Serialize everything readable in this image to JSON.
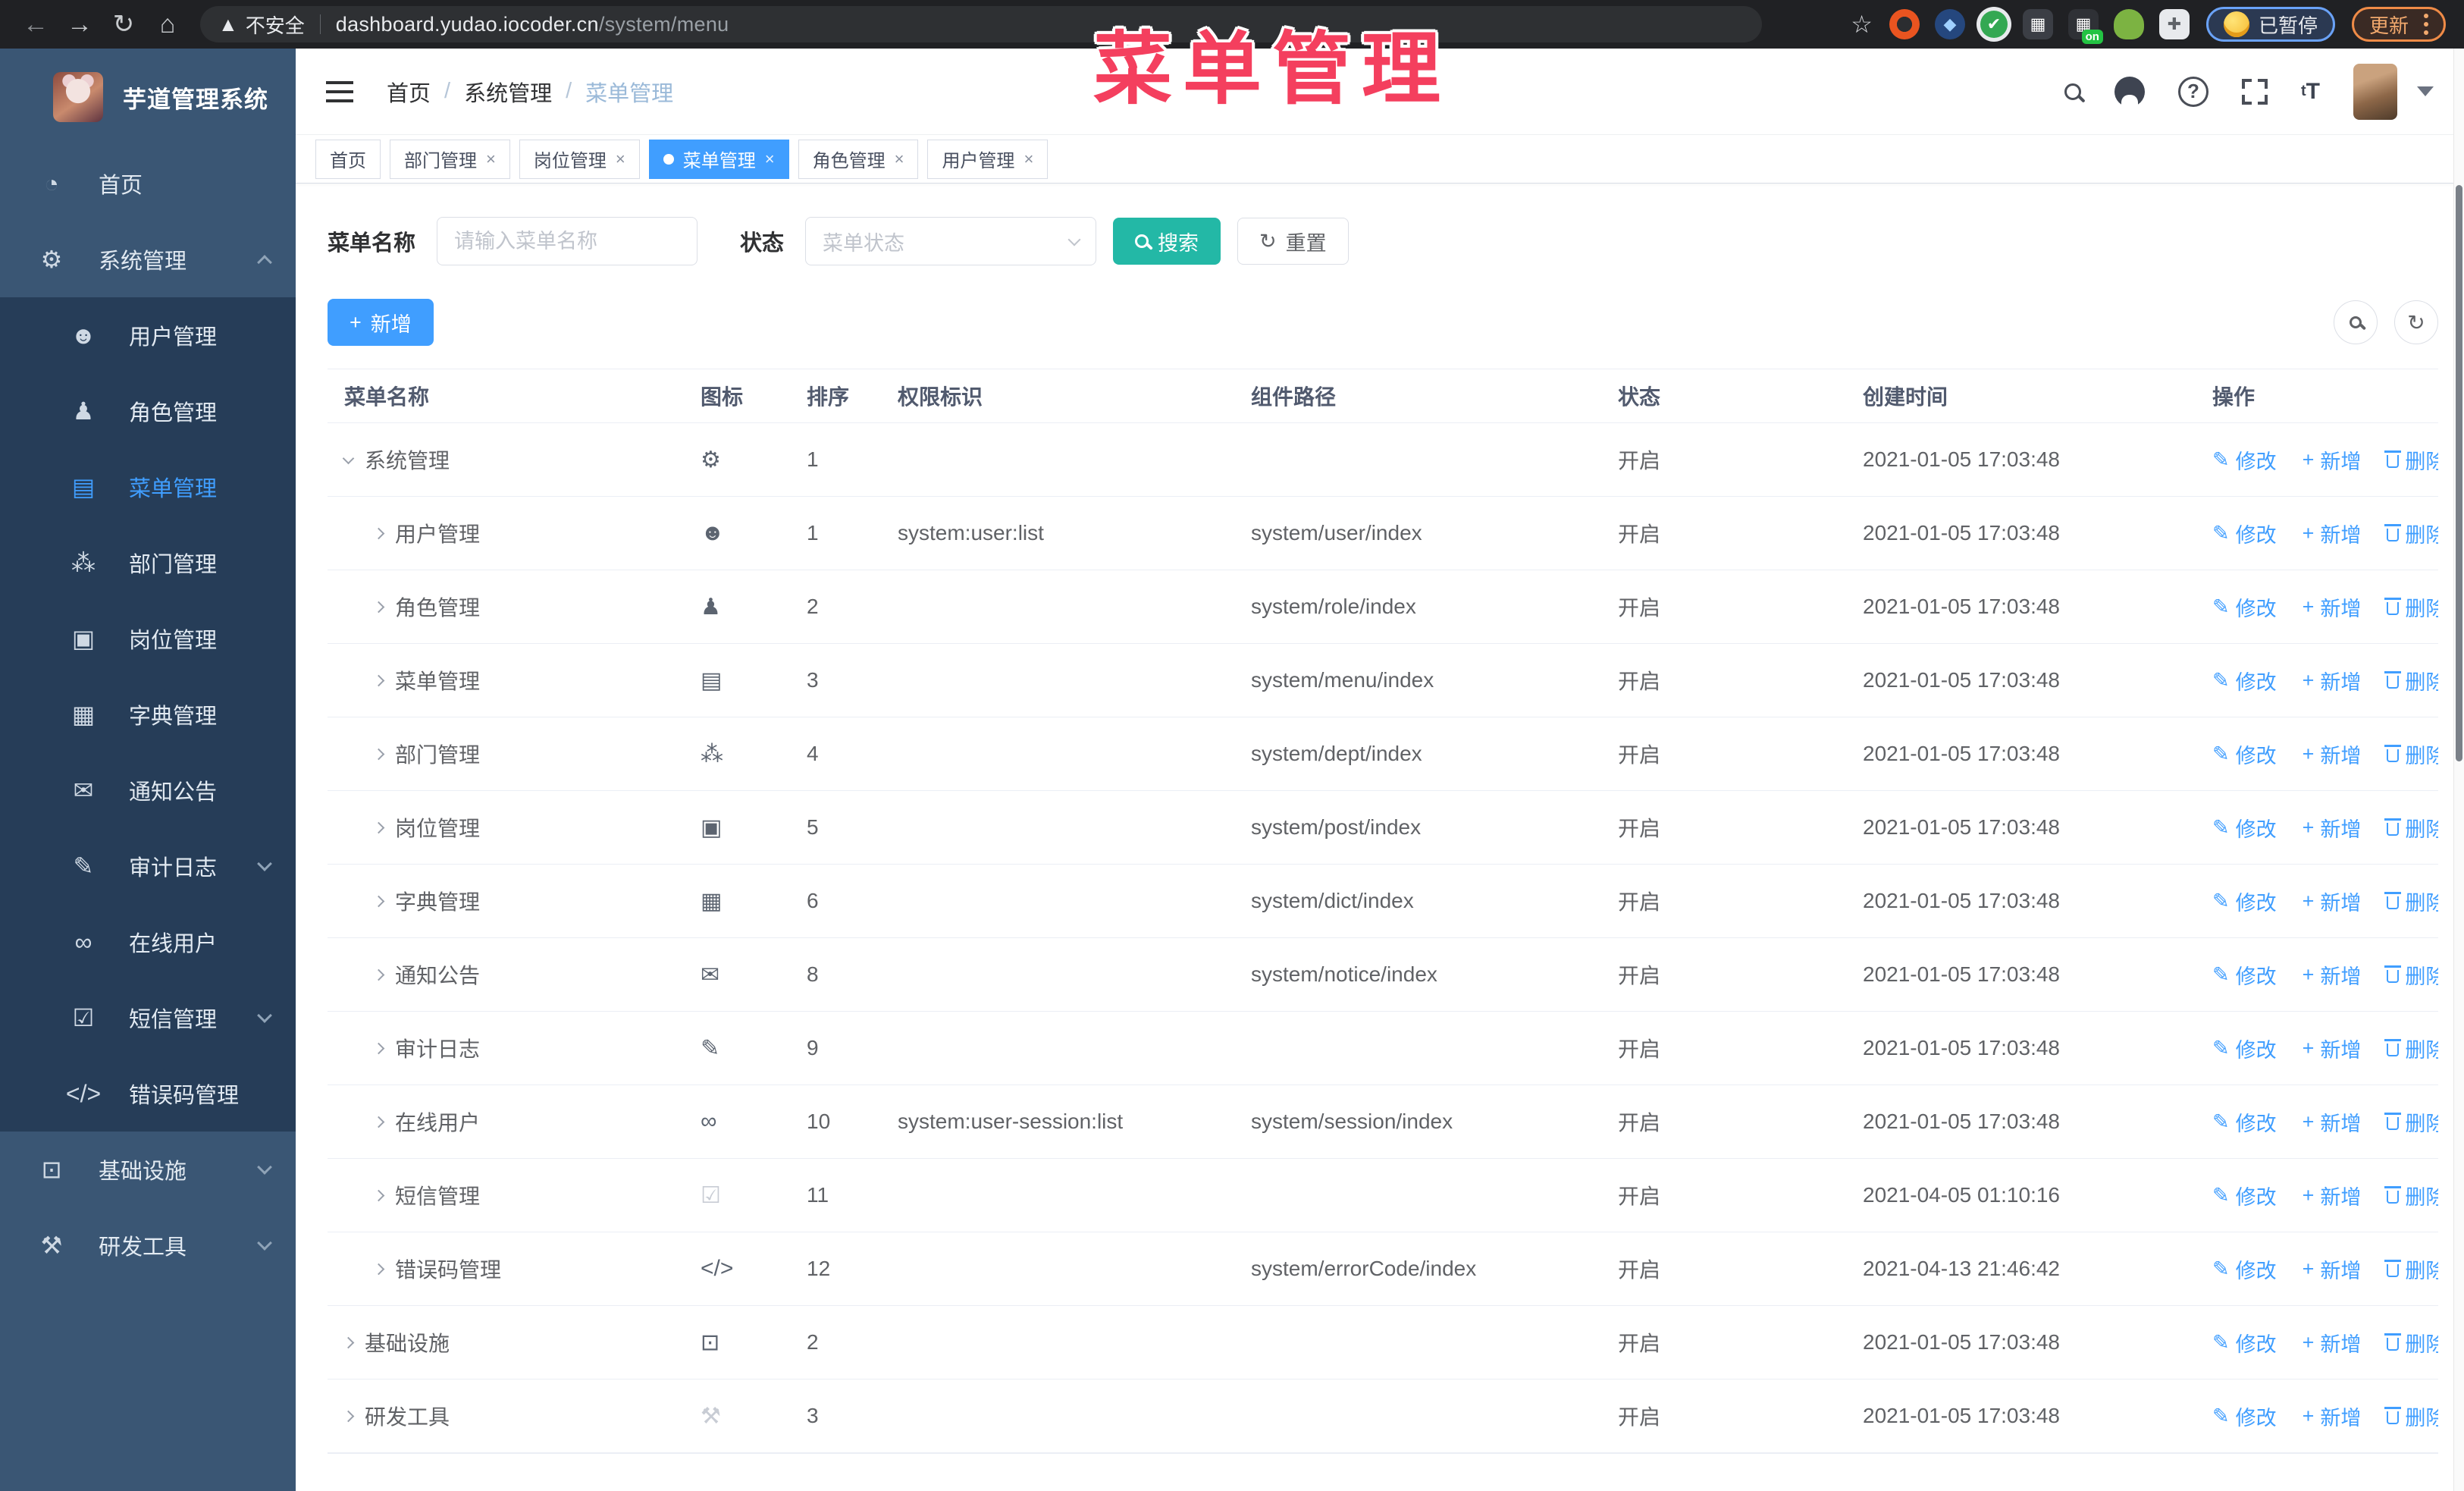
{
  "colors": {
    "accent": "#409eff",
    "search_button": "#23b8a6",
    "annotation": "#f43f5e",
    "sidebar_bg": "#3a5674",
    "submenu_bg": "#263d58"
  },
  "annotation": {
    "text": "菜单管理"
  },
  "browser": {
    "security_label": "不安全",
    "url_host": "dashboard.yudao.iocoder.cn",
    "url_path": "/system/menu",
    "paused_badge": "已暂停",
    "update_button": "更新",
    "nav_icons": [
      "back-icon",
      "forward-icon",
      "reload-icon",
      "home-icon"
    ],
    "extensions": [
      "ubuntu-orange-extension",
      "blue-gem-extension",
      "green-check-extension",
      "blue-grid-extension",
      "on-badge-extension",
      "green-bot-extension",
      "white-puzzle-extension"
    ],
    "on_badge": "on"
  },
  "sidebar": {
    "logo_title": "芋道管理系统",
    "items": [
      {
        "label": "首页",
        "icon": "dashboard-icon",
        "type": "root",
        "active": false,
        "chevron": ""
      },
      {
        "label": "系统管理",
        "icon": "gear-icon",
        "type": "root",
        "active": false,
        "chevron": "up"
      },
      {
        "label": "用户管理",
        "icon": "user-icon",
        "type": "sub",
        "active": false,
        "chevron": ""
      },
      {
        "label": "角色管理",
        "icon": "role-icon",
        "type": "sub",
        "active": false,
        "chevron": ""
      },
      {
        "label": "菜单管理",
        "icon": "menu-icon",
        "type": "sub",
        "active": true,
        "chevron": ""
      },
      {
        "label": "部门管理",
        "icon": "dept-icon",
        "type": "sub",
        "active": false,
        "chevron": ""
      },
      {
        "label": "岗位管理",
        "icon": "post-icon",
        "type": "sub",
        "active": false,
        "chevron": ""
      },
      {
        "label": "字典管理",
        "icon": "dict-icon",
        "type": "sub",
        "active": false,
        "chevron": ""
      },
      {
        "label": "通知公告",
        "icon": "notice-icon",
        "type": "sub",
        "active": false,
        "chevron": ""
      },
      {
        "label": "审计日志",
        "icon": "audit-icon",
        "type": "sub",
        "active": false,
        "chevron": "down"
      },
      {
        "label": "在线用户",
        "icon": "online-icon",
        "type": "sub",
        "active": false,
        "chevron": ""
      },
      {
        "label": "短信管理",
        "icon": "sms-icon",
        "type": "sub",
        "active": false,
        "chevron": "down"
      },
      {
        "label": "错误码管理",
        "icon": "errcode-icon",
        "type": "sub",
        "active": false,
        "chevron": ""
      },
      {
        "label": "基础设施",
        "icon": "infra-icon",
        "type": "root",
        "active": false,
        "chevron": "down"
      },
      {
        "label": "研发工具",
        "icon": "tools-icon",
        "type": "root",
        "active": false,
        "chevron": "down"
      }
    ]
  },
  "header": {
    "breadcrumb": [
      "首页",
      "系统管理",
      "菜单管理"
    ],
    "icons": [
      "search-icon",
      "github-icon",
      "help-icon",
      "fullscreen-icon",
      "font-size-icon",
      "avatar",
      "caret-down-icon"
    ],
    "font_size_glyph": "tT"
  },
  "tabs": [
    {
      "label": "首页",
      "closable": false,
      "active": false
    },
    {
      "label": "部门管理",
      "closable": true,
      "active": false
    },
    {
      "label": "岗位管理",
      "closable": true,
      "active": false
    },
    {
      "label": "菜单管理",
      "closable": true,
      "active": true
    },
    {
      "label": "角色管理",
      "closable": true,
      "active": false
    },
    {
      "label": "用户管理",
      "closable": true,
      "active": false
    }
  ],
  "filters": {
    "name_label": "菜单名称",
    "name_placeholder": "请输入菜单名称",
    "name_value": "",
    "status_label": "状态",
    "status_placeholder": "菜单状态",
    "search_button": "搜索",
    "reset_button": "重置"
  },
  "toolbar": {
    "add_button": "新增"
  },
  "table": {
    "columns": [
      "菜单名称",
      "图标",
      "排序",
      "权限标识",
      "组件路径",
      "状态",
      "创建时间",
      "操作"
    ],
    "actions": {
      "edit": "修改",
      "add": "新增",
      "delete": "删除"
    },
    "rows": [
      {
        "name": "系统管理",
        "icon": "gear-icon",
        "level": 0,
        "expanded": true,
        "sort": "1",
        "perm": "",
        "path": "",
        "status": "开启",
        "time": "2021-01-05 17:03:48"
      },
      {
        "name": "用户管理",
        "icon": "user-icon",
        "level": 1,
        "expanded": false,
        "sort": "1",
        "perm": "system:user:list",
        "path": "system/user/index",
        "status": "开启",
        "time": "2021-01-05 17:03:48"
      },
      {
        "name": "角色管理",
        "icon": "role-icon",
        "level": 1,
        "expanded": false,
        "sort": "2",
        "perm": "",
        "path": "system/role/index",
        "status": "开启",
        "time": "2021-01-05 17:03:48"
      },
      {
        "name": "菜单管理",
        "icon": "menu-icon",
        "level": 1,
        "expanded": false,
        "sort": "3",
        "perm": "",
        "path": "system/menu/index",
        "status": "开启",
        "time": "2021-01-05 17:03:48"
      },
      {
        "name": "部门管理",
        "icon": "dept-icon",
        "level": 1,
        "expanded": false,
        "sort": "4",
        "perm": "",
        "path": "system/dept/index",
        "status": "开启",
        "time": "2021-01-05 17:03:48"
      },
      {
        "name": "岗位管理",
        "icon": "post-icon",
        "level": 1,
        "expanded": false,
        "sort": "5",
        "perm": "",
        "path": "system/post/index",
        "status": "开启",
        "time": "2021-01-05 17:03:48"
      },
      {
        "name": "字典管理",
        "icon": "dict-icon",
        "level": 1,
        "expanded": false,
        "sort": "6",
        "perm": "",
        "path": "system/dict/index",
        "status": "开启",
        "time": "2021-01-05 17:03:48"
      },
      {
        "name": "通知公告",
        "icon": "notice-icon",
        "level": 1,
        "expanded": false,
        "sort": "8",
        "perm": "",
        "path": "system/notice/index",
        "status": "开启",
        "time": "2021-01-05 17:03:48"
      },
      {
        "name": "审计日志",
        "icon": "audit-icon",
        "level": 1,
        "expanded": false,
        "sort": "9",
        "perm": "",
        "path": "",
        "status": "开启",
        "time": "2021-01-05 17:03:48"
      },
      {
        "name": "在线用户",
        "icon": "online-icon",
        "level": 1,
        "expanded": false,
        "sort": "10",
        "perm": "system:user-session:list",
        "path": "system/session/index",
        "status": "开启",
        "time": "2021-01-05 17:03:48"
      },
      {
        "name": "短信管理",
        "icon": "sms-icon",
        "level": 1,
        "expanded": false,
        "sort": "11",
        "perm": "",
        "path": "",
        "status": "开启",
        "time": "2021-04-05 01:10:16"
      },
      {
        "name": "错误码管理",
        "icon": "errcode-icon",
        "level": 1,
        "expanded": false,
        "sort": "12",
        "perm": "",
        "path": "system/errorCode/index",
        "status": "开启",
        "time": "2021-04-13 21:46:42"
      },
      {
        "name": "基础设施",
        "icon": "infra-icon",
        "level": 0,
        "expanded": false,
        "sort": "2",
        "perm": "",
        "path": "",
        "status": "开启",
        "time": "2021-01-05 17:03:48"
      },
      {
        "name": "研发工具",
        "icon": "tools-icon",
        "level": 0,
        "expanded": false,
        "sort": "3",
        "perm": "",
        "path": "",
        "status": "开启",
        "time": "2021-01-05 17:03:48"
      }
    ]
  }
}
